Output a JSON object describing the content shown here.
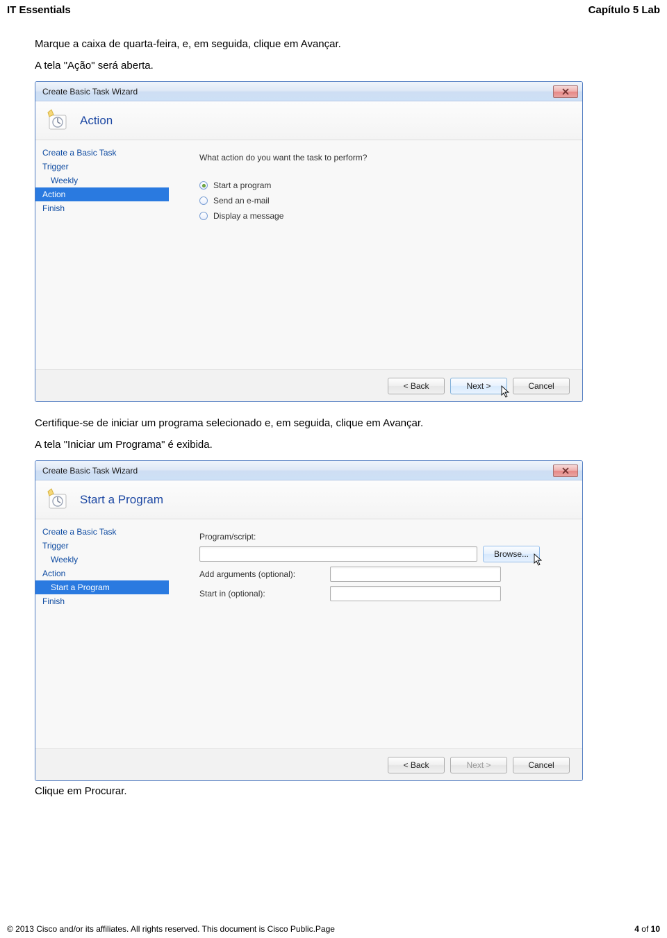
{
  "header": {
    "left": "IT Essentials",
    "right": "Capítulo 5 Lab"
  },
  "intro": {
    "p1": "Marque a caixa de quarta-feira, e, em seguida, clique em Avançar.",
    "p2": "A tela \"Ação\" será aberta."
  },
  "wizard1": {
    "title": "Create Basic Task Wizard",
    "header": "Action",
    "nav": {
      "create": "Create a Basic Task",
      "trigger": "Trigger",
      "weekly": "Weekly",
      "action": "Action",
      "finish": "Finish"
    },
    "prompt": "What action do you want the task to perform?",
    "opt1": "Start a program",
    "opt2": "Send an e-mail",
    "opt3": "Display a message",
    "buttons": {
      "back": "< Back",
      "next": "Next >",
      "cancel": "Cancel"
    }
  },
  "mid": {
    "p1": "Certifique-se de iniciar um programa selecionado e, em seguida, clique em Avançar.",
    "p2": "A tela \"Iniciar um Programa\" é exibida."
  },
  "wizard2": {
    "title": "Create Basic Task Wizard",
    "header": "Start a Program",
    "nav": {
      "create": "Create a Basic Task",
      "trigger": "Trigger",
      "weekly": "Weekly",
      "action": "Action",
      "start": "Start a Program",
      "finish": "Finish"
    },
    "labels": {
      "program": "Program/script:",
      "args": "Add arguments (optional):",
      "startin": "Start in (optional):"
    },
    "browse": "Browse...",
    "buttons": {
      "back": "< Back",
      "next": "Next >",
      "cancel": "Cancel"
    }
  },
  "after2": "Clique em Procurar.",
  "footer": {
    "copy": "© 2013 Cisco and/or its affiliates. All rights reserved. This document is Cisco Public.Page",
    "page_current": "4",
    "page_of": " of ",
    "page_total": "10"
  }
}
